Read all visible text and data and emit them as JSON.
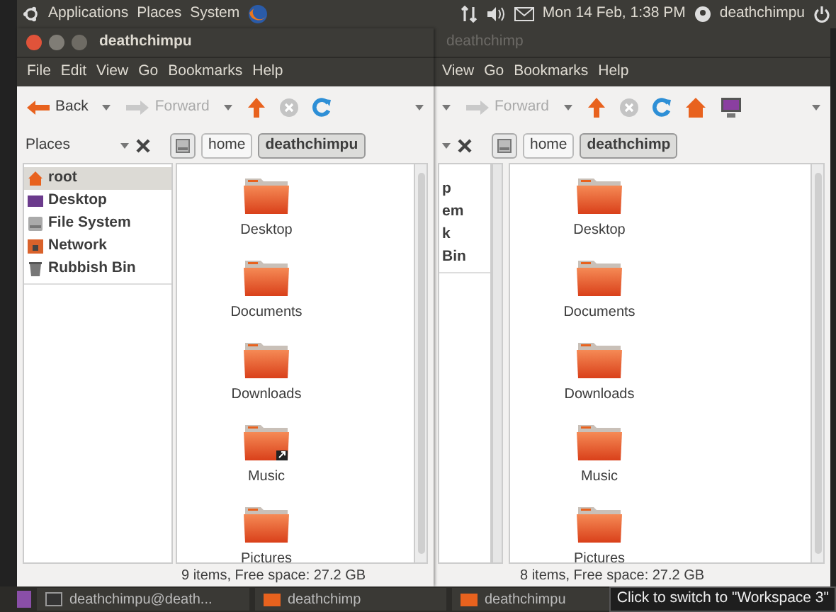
{
  "top_panel": {
    "menus": [
      "Applications",
      "Places",
      "System"
    ],
    "clock": "Mon 14 Feb, 1:38 PM",
    "user": "deathchimpu"
  },
  "windows": [
    {
      "title": "deathchimpu",
      "active": true,
      "menu": [
        "File",
        "Edit",
        "View",
        "Go",
        "Bookmarks",
        "Help"
      ],
      "toolbar": [
        {
          "kind": "back",
          "label": "Back",
          "disabled": false
        },
        {
          "kind": "forward",
          "label": "Forward",
          "disabled": true
        },
        {
          "kind": "up"
        },
        {
          "kind": "stop"
        },
        {
          "kind": "reload"
        }
      ],
      "sidebar_title": "Places",
      "path": [
        {
          "label": "home",
          "selected": false
        },
        {
          "label": "deathchimpu",
          "selected": true
        }
      ],
      "sidebar": [
        {
          "label": "root",
          "kind": "home",
          "selected": true
        },
        {
          "label": "Desktop",
          "kind": "desktop",
          "selected": false
        },
        {
          "label": "File System",
          "kind": "drive",
          "selected": false
        },
        {
          "label": "Network",
          "kind": "network",
          "selected": false
        },
        {
          "label": "Rubbish Bin",
          "kind": "trash",
          "selected": false
        }
      ],
      "folders": [
        {
          "label": "Desktop",
          "link": false
        },
        {
          "label": "Documents",
          "link": false
        },
        {
          "label": "Downloads",
          "link": false
        },
        {
          "label": "Music",
          "link": true
        },
        {
          "label": "Pictures",
          "link": false
        }
      ],
      "status": "9 items, Free space: 27.2 GB"
    },
    {
      "title": "deathchimp",
      "active": false,
      "menu": [
        "View",
        "Go",
        "Bookmarks",
        "Help"
      ],
      "toolbar": [
        {
          "kind": "caret"
        },
        {
          "kind": "forward",
          "label": "Forward",
          "disabled": true
        },
        {
          "kind": "up"
        },
        {
          "kind": "stop"
        },
        {
          "kind": "reload"
        },
        {
          "kind": "home"
        },
        {
          "kind": "computer"
        }
      ],
      "path": [
        {
          "label": "home",
          "selected": false
        },
        {
          "label": "deathchimp",
          "selected": true
        }
      ],
      "sidebar": [
        {
          "label": "p",
          "selected": false
        },
        {
          "label": "em",
          "selected": false
        },
        {
          "label": "k",
          "selected": false
        },
        {
          "label": "Bin",
          "selected": false
        }
      ],
      "folders": [
        {
          "label": "Desktop",
          "link": false
        },
        {
          "label": "Documents",
          "link": false
        },
        {
          "label": "Downloads",
          "link": false
        },
        {
          "label": "Music",
          "link": false
        },
        {
          "label": "Pictures",
          "link": false
        }
      ],
      "status": "8 items, Free space: 27.2 GB"
    }
  ],
  "taskbar": {
    "items": [
      {
        "label": "deathchimpu@death...",
        "kind": "terminal"
      },
      {
        "label": "deathchimp",
        "kind": "folder"
      },
      {
        "label": "deathchimpu",
        "kind": "folder"
      }
    ],
    "tooltip": "Click to switch to \"Workspace 3\""
  }
}
